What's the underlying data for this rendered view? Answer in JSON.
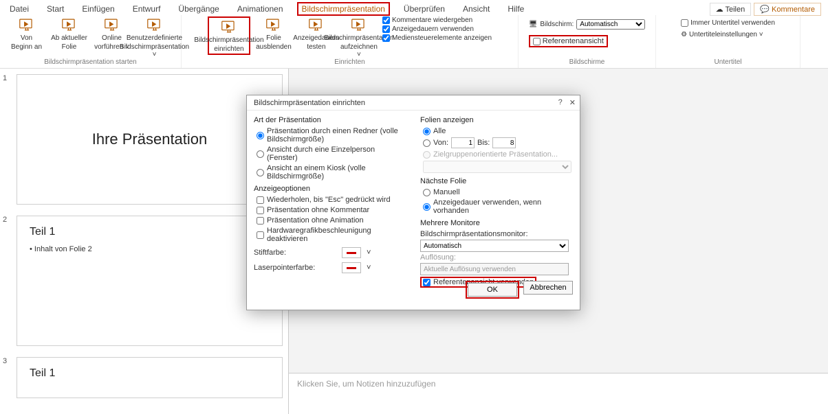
{
  "topright": {
    "share": "Teilen",
    "comments": "Kommentare"
  },
  "tabs": [
    "Datei",
    "Start",
    "Einfügen",
    "Entwurf",
    "Übergänge",
    "Animationen",
    "Bildschirmpräsentation",
    "Überprüfen",
    "Ansicht",
    "Hilfe"
  ],
  "active_tab_index": 6,
  "ribbon": {
    "group_start": {
      "label": "Bildschirmpräsentation starten",
      "btns": [
        {
          "name": "from-beginning",
          "l1": "Von",
          "l2": "Beginn an"
        },
        {
          "name": "from-current",
          "l1": "Ab aktueller",
          "l2": "Folie"
        },
        {
          "name": "present-online",
          "l1": "Online",
          "l2": "vorführen ˅"
        },
        {
          "name": "custom-show",
          "l1": "Benutzerdefinierte",
          "l2": "Bildschirmpräsentation ˅"
        }
      ]
    },
    "group_setup": {
      "label": "Einrichten",
      "btns": [
        {
          "name": "setup-show",
          "l1": "Bildschirmpräsentation",
          "l2": "einrichten",
          "boxed": true
        },
        {
          "name": "hide-slide",
          "l1": "Folie",
          "l2": "ausblenden"
        },
        {
          "name": "rehearse",
          "l1": "Anzeigedauern",
          "l2": "testen"
        },
        {
          "name": "record",
          "l1": "Bildschirmpräsentation",
          "l2": "aufzeichnen ˅"
        }
      ],
      "checks": [
        "Kommentare wiedergeben",
        "Anzeigedauern verwenden",
        "Mediensteuerelemente anzeigen"
      ]
    },
    "group_monitors": {
      "label": "Bildschirme",
      "screen_label": "Bildschirm:",
      "screen_value": "Automatisch",
      "presenter_view": "Referentenansicht"
    },
    "group_subtitles": {
      "label": "Untertitel",
      "always": "Immer Untertitel verwenden",
      "settings": "Untertiteleinstellungen ˅"
    }
  },
  "thumbs": [
    {
      "num": "1",
      "type": "title",
      "title": "Ihre Präsentation"
    },
    {
      "num": "2",
      "type": "content",
      "title": "Teil 1",
      "bullet": "• Inhalt von Folie 2"
    },
    {
      "num": "3",
      "type": "content",
      "title": "Teil 1",
      "bullet": ""
    }
  ],
  "notes_placeholder": "Klicken Sie, um Notizen hinzuzufügen",
  "dialog": {
    "title": "Bildschirmpräsentation einrichten",
    "help": "?",
    "close": "✕",
    "l": {
      "art": {
        "label": "Art der Präsentation",
        "o1": "Präsentation durch einen Redner (volle Bildschirmgröße)",
        "o2": "Ansicht durch eine Einzelperson (Fenster)",
        "o3": "Ansicht an einem Kiosk (volle Bildschirmgröße)"
      },
      "anz": {
        "label": "Anzeigeoptionen",
        "c1": "Wiederholen, bis \"Esc\" gedrückt wird",
        "c2": "Präsentation ohne Kommentar",
        "c3": "Präsentation ohne Animation",
        "c4": "Hardwaregrafikbeschleunigung deaktivieren"
      },
      "pen": "Stiftfarbe:",
      "laser": "Laserpointerfarbe:"
    },
    "r": {
      "show": {
        "label": "Folien anzeigen",
        "all": "Alle",
        "from": "Von:",
        "from_v": "1",
        "to": "Bis:",
        "to_v": "8",
        "custom": "Zielgruppenorientierte Präsentation..."
      },
      "next": {
        "label": "Nächste Folie",
        "o1": "Manuell",
        "o2": "Anzeigedauer verwenden, wenn vorhanden"
      },
      "mon": {
        "label": "Mehrere Monitore",
        "monlabel": "Bildschirmpräsentationsmonitor:",
        "monval": "Automatisch",
        "reslabel": "Auflösung:",
        "resval": "Aktuelle Auflösung verwenden",
        "presenter": "Referentenansicht verwenden"
      }
    },
    "ok": "OK",
    "cancel": "Abbrechen"
  }
}
